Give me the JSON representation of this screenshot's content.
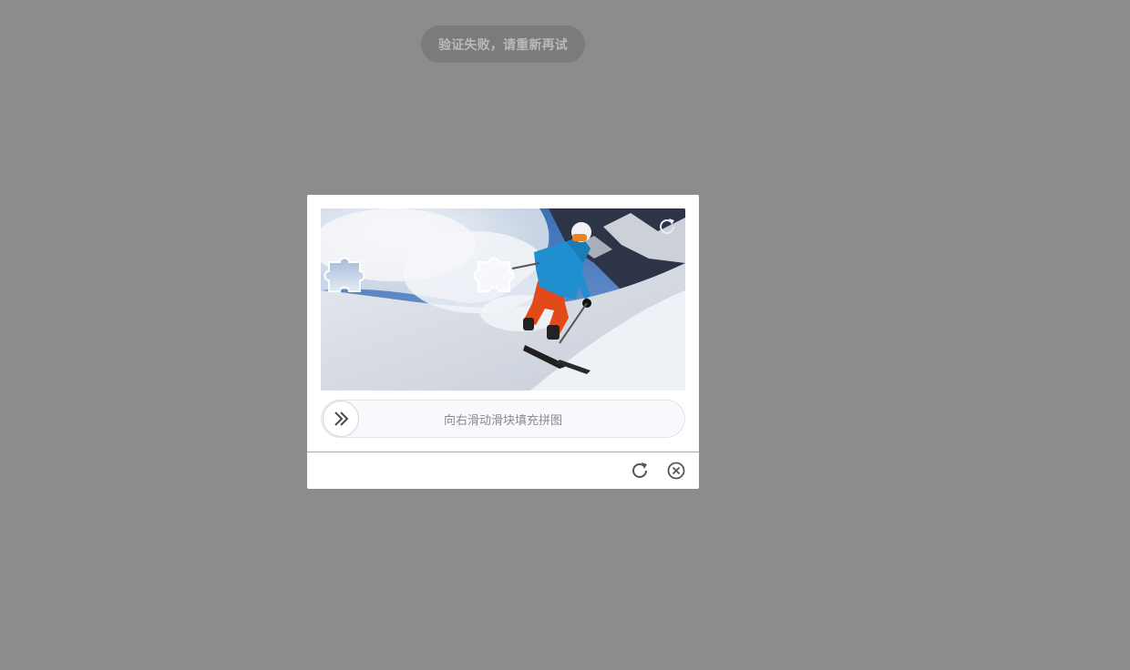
{
  "toast": {
    "message": "验证失败，请重新再试"
  },
  "captcha": {
    "slider_hint": "向右滑动滑块填充拼图",
    "image_subject": "skier on snowy mountain slope",
    "icons": {
      "panel_refresh": "refresh-icon",
      "slider_knob": "double-chevron-right-icon",
      "footer_refresh": "refresh-icon",
      "footer_close": "close-circle-icon"
    }
  },
  "colors": {
    "overlay": "#8c8c8c",
    "toast_bg": "#7b7b7b",
    "toast_text": "#b9b9b9",
    "dialog_bg": "#ffffff",
    "slider_bg": "#f7f9fc",
    "hint_text": "#8a8a8a",
    "icon_dark": "#555555"
  }
}
